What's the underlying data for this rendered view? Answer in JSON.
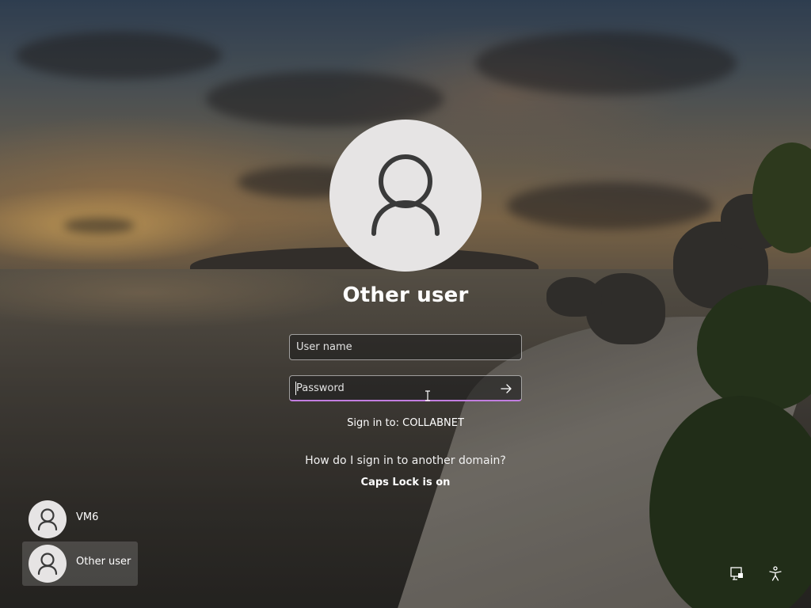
{
  "login": {
    "title": "Other user",
    "username_placeholder": "User name",
    "username_value": "",
    "password_placeholder": "Password",
    "password_value": "",
    "sign_in_to": "Sign in to: COLLABNET",
    "domain_help_link": "How do I sign in to another domain?",
    "caps_lock_warning": "Caps Lock is on",
    "submit_icon": "arrow-right-icon",
    "accent_color": "#c27ee0"
  },
  "users": [
    {
      "label": "VM6",
      "icon": "user-avatar-icon",
      "selected": false
    },
    {
      "label": "Other user",
      "icon": "user-avatar-icon",
      "selected": true
    }
  ],
  "system_icons": [
    {
      "name": "network-icon"
    },
    {
      "name": "accessibility-icon"
    }
  ]
}
